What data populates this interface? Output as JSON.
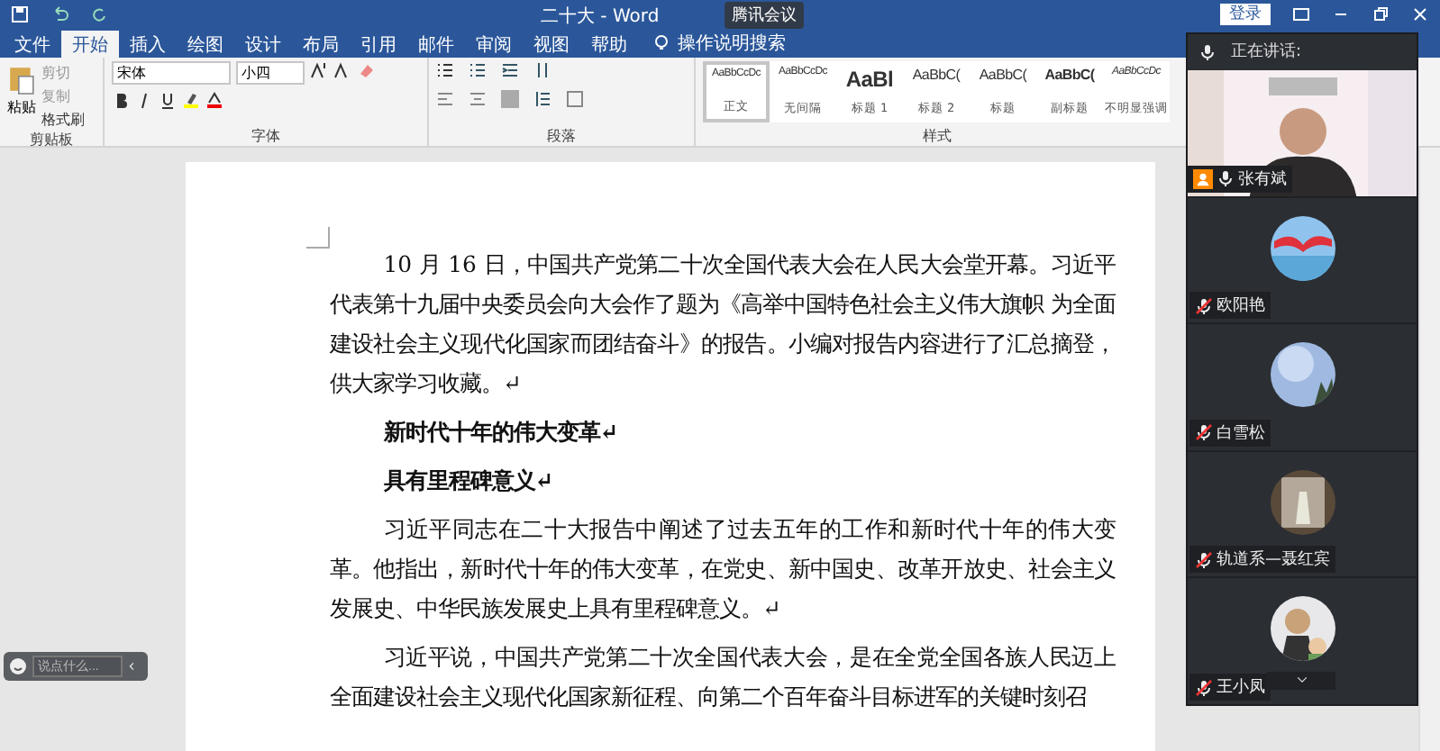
{
  "title_bar": {
    "title": "二十大 - Word",
    "meeting_badge": "腾讯会议",
    "login": "登录"
  },
  "tabs": [
    {
      "label": "文件",
      "selected": false
    },
    {
      "label": "开始",
      "selected": true
    },
    {
      "label": "插入",
      "selected": false
    },
    {
      "label": "绘图",
      "selected": false
    },
    {
      "label": "设计",
      "selected": false
    },
    {
      "label": "布局",
      "selected": false
    },
    {
      "label": "引用",
      "selected": false
    },
    {
      "label": "邮件",
      "selected": false
    },
    {
      "label": "审阅",
      "selected": false
    },
    {
      "label": "视图",
      "selected": false
    },
    {
      "label": "帮助",
      "selected": false
    }
  ],
  "tell_me": "操作说明搜索",
  "clipboard": {
    "paste": "粘贴",
    "cut": "剪切",
    "copy": "复制",
    "format_painter": "格式刷",
    "label": "剪贴板"
  },
  "font": {
    "name": "宋体",
    "size": "小四",
    "label": "字体"
  },
  "paragraph": {
    "label": "段落"
  },
  "styles": {
    "label": "样式",
    "items": [
      {
        "preview": "AaBbCcDc",
        "name": "正文",
        "kind": "normal",
        "selected": true
      },
      {
        "preview": "AaBbCcDc",
        "name": "无间隔",
        "kind": "normal",
        "selected": false
      },
      {
        "preview": "AaBl",
        "name": "标题 1",
        "kind": "heading1",
        "selected": false
      },
      {
        "preview": "AaBbC(",
        "name": "标题 2",
        "kind": "heading2",
        "selected": false
      },
      {
        "preview": "AaBbC(",
        "name": "标题",
        "kind": "title",
        "selected": false
      },
      {
        "preview": "AaBbC(",
        "name": "副标题",
        "kind": "subtitle",
        "selected": false
      },
      {
        "preview": "AaBbCcDc",
        "name": "不明显强调",
        "kind": "emphasis",
        "selected": false
      }
    ]
  },
  "document": {
    "paragraphs": [
      {
        "kind": "body",
        "text": "10 月 16 日，中国共产党第二十次全国代表大会在人民大会堂开幕。习近平代表第十九届中央委员会向大会作了题为《高举中国特色社会主义伟大旗帜 为全面建设社会主义现代化国家而团结奋斗》的报告。小编对报告内容进行了汇总摘登，供大家学习收藏。↵"
      },
      {
        "kind": "heading",
        "text": "新时代十年的伟大变革↵"
      },
      {
        "kind": "heading",
        "text": "具有里程碑意义↵"
      },
      {
        "kind": "body",
        "text": "习近平同志在二十大报告中阐述了过去五年的工作和新时代十年的伟大变革。他指出，新时代十年的伟大变革，在党史、新中国史、改革开放史、社会主义发展史、中华民族发展史上具有里程碑意义。↵"
      },
      {
        "kind": "body",
        "text": "习近平说，中国共产党第二十次全国代表大会，是在全党全国各族人民迈上全面建设社会主义现代化国家新征程、向第二个百年奋斗目标进军的关键时刻召"
      }
    ]
  },
  "meeting": {
    "speaking_label": "正在讲话:",
    "speaker": {
      "name": "张有斌",
      "muted": false
    },
    "participants": [
      {
        "name": "欧阳艳",
        "muted": true
      },
      {
        "name": "白雪松",
        "muted": true
      },
      {
        "name": "轨道系—聂红宾",
        "muted": true
      },
      {
        "name": "王小凤",
        "muted": true
      }
    ]
  },
  "chat": {
    "placeholder": "说点什么..."
  }
}
